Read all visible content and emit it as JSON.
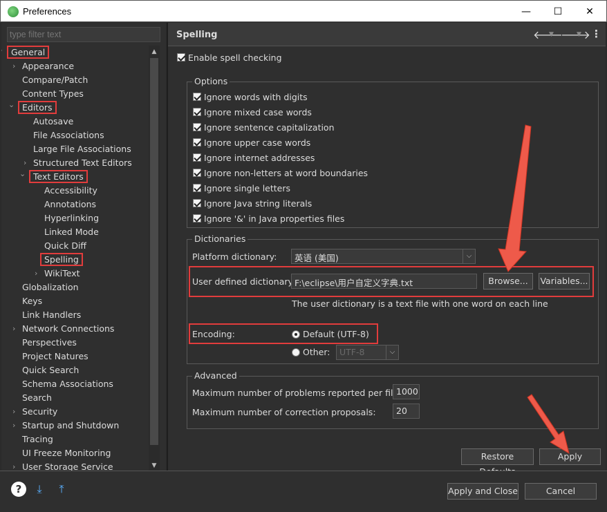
{
  "window": {
    "title": "Preferences",
    "min": "—",
    "max": "☐",
    "close": "✕"
  },
  "filter": {
    "placeholder": "type filter text"
  },
  "tree": [
    {
      "label": "General",
      "level": 0,
      "expand": "down",
      "hl": true
    },
    {
      "label": "Appearance",
      "level": 1,
      "expand": "right"
    },
    {
      "label": "Compare/Patch",
      "level": 1
    },
    {
      "label": "Content Types",
      "level": 1
    },
    {
      "label": "Editors",
      "level": 1,
      "expand": "down",
      "hl": true
    },
    {
      "label": "Autosave",
      "level": 2
    },
    {
      "label": "File Associations",
      "level": 2
    },
    {
      "label": "Large File Associations",
      "level": 2
    },
    {
      "label": "Structured Text Editors",
      "level": 2,
      "expand": "right"
    },
    {
      "label": "Text Editors",
      "level": 2,
      "expand": "down",
      "hl": true
    },
    {
      "label": "Accessibility",
      "level": 3
    },
    {
      "label": "Annotations",
      "level": 3
    },
    {
      "label": "Hyperlinking",
      "level": 3
    },
    {
      "label": "Linked Mode",
      "level": 3
    },
    {
      "label": "Quick Diff",
      "level": 3
    },
    {
      "label": "Spelling",
      "level": 3,
      "hl": true,
      "selected": true
    },
    {
      "label": "WikiText",
      "level": 3,
      "expand": "right"
    },
    {
      "label": "Globalization",
      "level": 1
    },
    {
      "label": "Keys",
      "level": 1
    },
    {
      "label": "Link Handlers",
      "level": 1
    },
    {
      "label": "Network Connections",
      "level": 1,
      "expand": "right"
    },
    {
      "label": "Perspectives",
      "level": 1
    },
    {
      "label": "Project Natures",
      "level": 1
    },
    {
      "label": "Quick Search",
      "level": 1
    },
    {
      "label": "Schema Associations",
      "level": 1
    },
    {
      "label": "Search",
      "level": 1
    },
    {
      "label": "Security",
      "level": 1,
      "expand": "right"
    },
    {
      "label": "Startup and Shutdown",
      "level": 1,
      "expand": "right"
    },
    {
      "label": "Tracing",
      "level": 1
    },
    {
      "label": "UI Freeze Monitoring",
      "level": 1
    },
    {
      "label": "User Storage Service",
      "level": 1,
      "expand": "right"
    }
  ],
  "page": {
    "title": "Spelling",
    "enable": "Enable spell checking",
    "options_title": "Options",
    "options": [
      "Ignore words with digits",
      "Ignore mixed case words",
      "Ignore sentence capitalization",
      "Ignore upper case words",
      "Ignore internet addresses",
      "Ignore non-letters at word boundaries",
      "Ignore single letters",
      "Ignore Java string literals",
      "Ignore '&' in Java properties files"
    ],
    "dict_title": "Dictionaries",
    "platform_label": "Platform dictionary:",
    "platform_value": "英语 (美国)",
    "user_label": "User defined dictionary:",
    "user_value": "F:\\eclipse\\用户自定义字典.txt",
    "browse": "Browse...",
    "variables": "Variables...",
    "hint": "The user dictionary is a text file with one word on each line",
    "encoding_label": "Encoding:",
    "default_enc": "Default (UTF-8)",
    "other_label": "Other:",
    "other_value": "UTF-8",
    "adv_title": "Advanced",
    "max_problems_label": "Maximum number of problems reported per file:",
    "max_problems_value": "1000",
    "max_corrections_label": "Maximum number of correction proposals:",
    "max_corrections_value": "20",
    "restore": "Restore Defaults",
    "apply": "Apply"
  },
  "footer": {
    "apply_close": "Apply and Close",
    "cancel": "Cancel"
  },
  "colors": {
    "highlight": "#e23c3c",
    "background": "#2f2f2f"
  }
}
